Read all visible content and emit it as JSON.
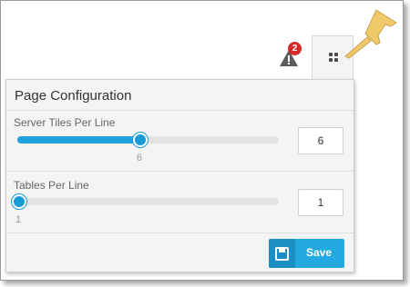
{
  "toolbar": {
    "alert_count": "2"
  },
  "panel": {
    "title": "Page Configuration",
    "sliders": [
      {
        "label": "Server Tiles Per Line",
        "value": 6,
        "tick_label": "6",
        "input_value": "6",
        "fraction": 0.47
      },
      {
        "label": "Tables Per Line",
        "value": 1,
        "tick_label": "1",
        "input_value": "1",
        "fraction": 0.0
      }
    ],
    "save_label": "Save"
  },
  "colors": {
    "accent": "#1ea1dc",
    "badge": "#d42a2a",
    "pin": "#f0c96a"
  },
  "icons": [
    "alert-triangle-icon",
    "grid-icon",
    "pushpin-icon",
    "floppy-disk-icon"
  ]
}
